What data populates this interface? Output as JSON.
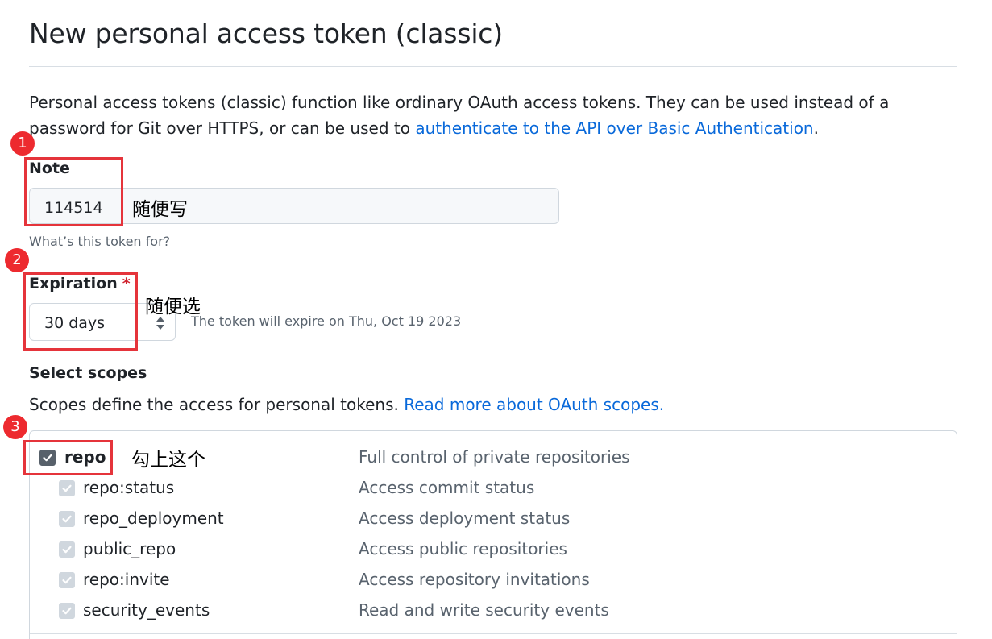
{
  "page": {
    "title": "New personal access token (classic)",
    "intro_text": "Personal access tokens (classic) function like ordinary OAuth access tokens. They can be used instead of a password for Git over HTTPS, or can be used to ",
    "intro_link": "authenticate to the API over Basic Authentication",
    "intro_end": "."
  },
  "note": {
    "label": "Note",
    "value": "114514",
    "hint": "What’s this token for?"
  },
  "expiration": {
    "label": "Expiration",
    "required_mark": "*",
    "selected": "30 days",
    "expiry_text": "The token will expire on Thu, Oct 19 2023"
  },
  "scopes": {
    "title": "Select scopes",
    "description": "Scopes define the access for personal tokens. ",
    "link": "Read more about OAuth scopes.",
    "main": {
      "name": "repo",
      "description": "Full control of private repositories",
      "checked": true
    },
    "items": [
      {
        "name": "repo:status",
        "description": "Access commit status",
        "checked": true
      },
      {
        "name": "repo_deployment",
        "description": "Access deployment status",
        "checked": true
      },
      {
        "name": "public_repo",
        "description": "Access public repositories",
        "checked": true
      },
      {
        "name": "repo:invite",
        "description": "Access repository invitations",
        "checked": true
      },
      {
        "name": "security_events",
        "description": "Read and write security events",
        "checked": true
      }
    ]
  },
  "annotations": {
    "markers": [
      "1",
      "2",
      "3"
    ],
    "note_hint": "随便写",
    "expiration_hint": "随便选",
    "repo_hint": "勾上这个"
  },
  "colors": {
    "link": "#0969da",
    "annotation_red": "#e5343b",
    "checkbox_main": "#57606a",
    "checkbox_sub": "#d0d7de"
  }
}
